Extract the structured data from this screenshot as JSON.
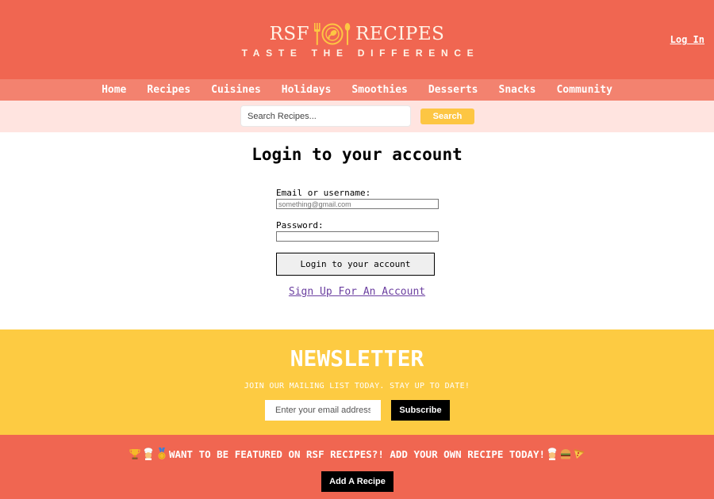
{
  "header": {
    "logo_left": "RSF",
    "logo_right": "RECIPES",
    "logo_icon": "plate-fork-spoon-icon",
    "tagline": "TASTE THE DIFFERENCE",
    "login_link": "Log In"
  },
  "nav": {
    "items": [
      "Home",
      "Recipes",
      "Cuisines",
      "Holidays",
      "Smoothies",
      "Desserts",
      "Snacks",
      "Community"
    ]
  },
  "search": {
    "placeholder": "Search Recipes...",
    "value": "",
    "button_label": "Search"
  },
  "login": {
    "title": "Login to your account",
    "email_label": "Email or username:",
    "email_placeholder": "something@gmail.com",
    "password_label": "Password:",
    "submit_label": "Login to your account",
    "signup_link": "Sign Up For An Account"
  },
  "newsletter": {
    "title": "NEWSLETTER",
    "subtitle": "JOIN OUR MAILING LIST TODAY. STAY UP TO DATE!",
    "email_placeholder": "Enter your email address",
    "button_label": "Subscribe"
  },
  "feature": {
    "leading_icons": [
      "trophy-icon",
      "chef-icon",
      "medal-icon"
    ],
    "text": "WANT TO BE FEATURED ON RSF RECIPES?! ADD YOUR OWN RECIPE TODAY!",
    "trailing_icons": [
      "chef-icon",
      "burger-icon",
      "pizza-icon"
    ],
    "button_label": "Add A Recipe"
  },
  "colors": {
    "header_bg": "#f06651",
    "nav_bg": "#f3826f",
    "search_bg": "#ffe4e0",
    "accent_yellow": "#fdc643",
    "newsletter_bg": "#fdcb42",
    "button_black": "#000000"
  }
}
